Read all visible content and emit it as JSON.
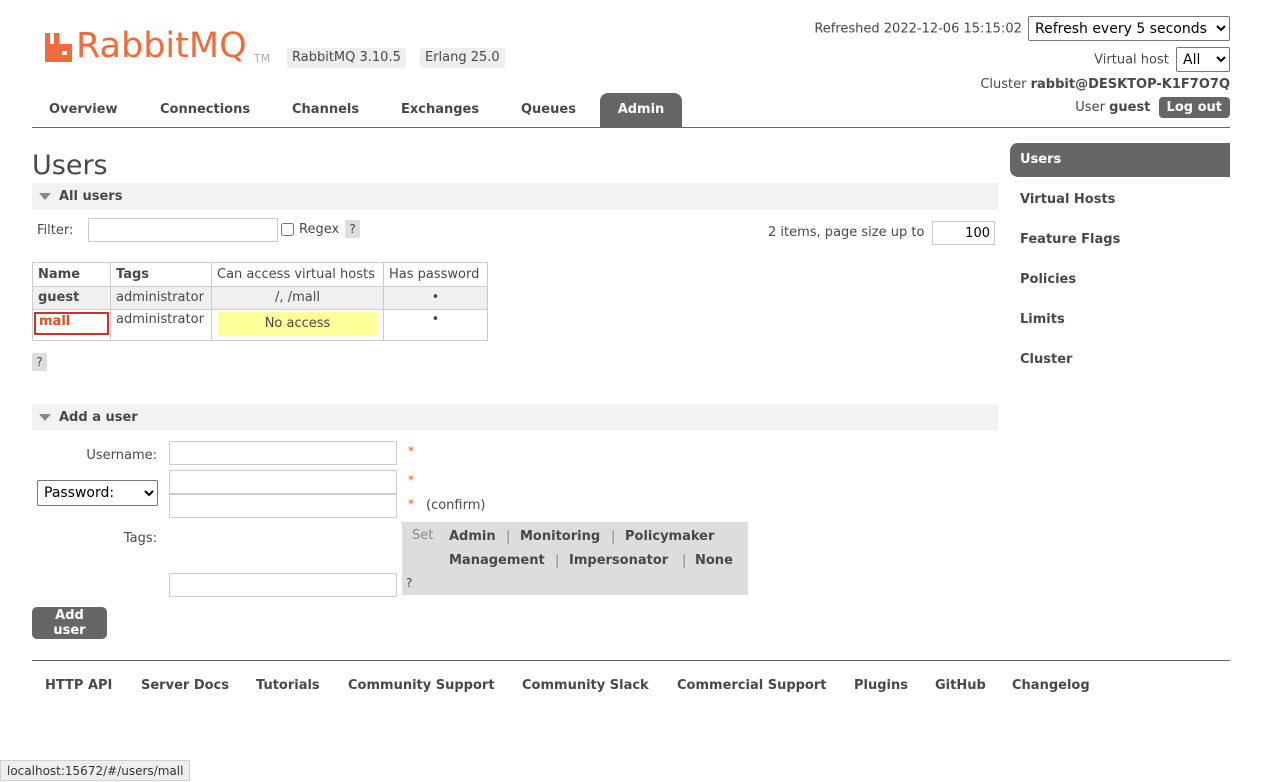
{
  "header": {
    "logo_text": "RabbitMQ",
    "logo_tm": "TM",
    "version_badge": "RabbitMQ 3.10.5",
    "erlang_badge": "Erlang 25.0",
    "refreshed_label": "Refreshed 2022-12-06 15:15:02",
    "refresh_select": "Refresh every 5 seconds",
    "vhost_label": "Virtual host",
    "vhost_select": "All",
    "cluster_label": "Cluster",
    "cluster_name": "rabbit@DESKTOP-K1F7O7Q",
    "user_label": "User",
    "user_name": "guest",
    "logout_label": "Log out",
    "brand_color": "#f26b3a"
  },
  "tabs": [
    {
      "label": "Overview",
      "active": false
    },
    {
      "label": "Connections",
      "active": false
    },
    {
      "label": "Channels",
      "active": false
    },
    {
      "label": "Exchanges",
      "active": false
    },
    {
      "label": "Queues",
      "active": false
    },
    {
      "label": "Admin",
      "active": true
    }
  ],
  "page_title": "Users",
  "all_users": {
    "section_title": "All users",
    "filter_label": "Filter:",
    "filter_value": "",
    "regex_label": "Regex",
    "help": "?",
    "pagination_text": "2 items, page size up to",
    "page_size": "100",
    "columns": [
      "Name",
      "Tags",
      "Can access virtual hosts",
      "Has password"
    ],
    "rows": [
      {
        "name": "guest",
        "tags": "administrator",
        "vhosts": "/, /mall",
        "has_password": "•"
      },
      {
        "name": "mall",
        "tags": "administrator",
        "vhosts": "No access",
        "has_password": "•"
      }
    ]
  },
  "add_user": {
    "section_title": "Add a user",
    "username_label": "Username:",
    "password_select": "Password:",
    "required_mark": "*",
    "confirm_label": "(confirm)",
    "tags_label": "Tags:",
    "set_label": "Set",
    "tag_options": [
      "Admin",
      "Monitoring",
      "Policymaker",
      "Management",
      "Impersonator",
      "None"
    ],
    "separator": "|",
    "help": "?",
    "submit_label": "Add user"
  },
  "sidebar": [
    {
      "label": "Users",
      "active": true
    },
    {
      "label": "Virtual Hosts",
      "active": false
    },
    {
      "label": "Feature Flags",
      "active": false
    },
    {
      "label": "Policies",
      "active": false
    },
    {
      "label": "Limits",
      "active": false
    },
    {
      "label": "Cluster",
      "active": false
    }
  ],
  "footer": [
    "HTTP API",
    "Server Docs",
    "Tutorials",
    "Community Support",
    "Community Slack",
    "Commercial Support",
    "Plugins",
    "GitHub",
    "Changelog"
  ],
  "status_bar": "localhost:15672/#/users/mall"
}
